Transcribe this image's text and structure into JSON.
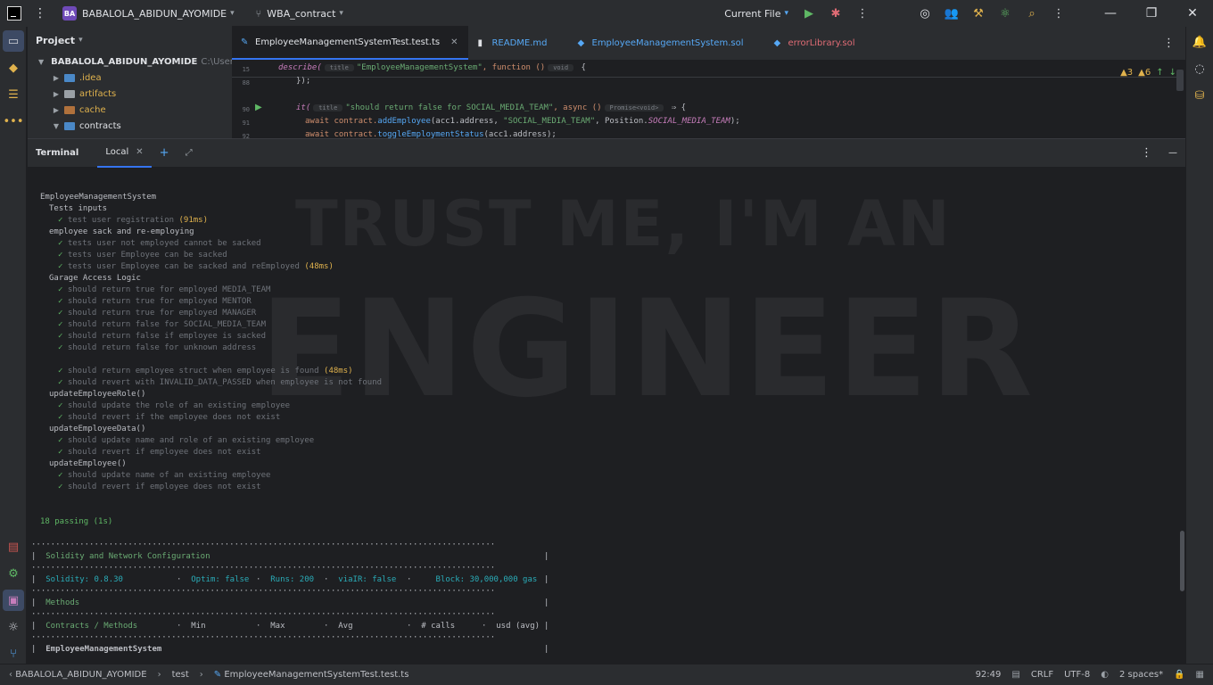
{
  "titlebar": {
    "project_badge": "BA",
    "project_name": "BABALOLA_ABIDUN_AYOMIDE",
    "branch": "WBA_contract",
    "run_config": "Current File"
  },
  "project_panel": {
    "title": "Project",
    "root": "BABALOLA_ABIDUN_AYOMIDE",
    "root_path": "C:\\Users\\",
    "items": [
      ".idea",
      "artifacts",
      "cache",
      "contracts"
    ]
  },
  "editor": {
    "tabs": [
      {
        "label": "EmployeeManagementSystemTest.test.ts"
      },
      {
        "label": "README.md"
      },
      {
        "label": "EmployeeManagementSystem.sol"
      },
      {
        "label": "errorLibrary.sol"
      }
    ],
    "warnings": "▲3",
    "weak_warnings": "▲6",
    "lines": {
      "l15": "15",
      "l88": "88",
      "l90": "90",
      "l91": "91",
      "l92": "92"
    },
    "code": {
      "describe_kw": "describe(",
      "describe_hint": "title",
      "describe_str": "\"EmployeeManagementSystem\"",
      "describe_rest": ", function ()",
      "describe_void": "void",
      "describe_end": " {",
      "close_line": "});",
      "it_kw": "it(",
      "it_hint": "title",
      "it_str": "\"should return false for SOCIAL_MEDIA_TEAM\"",
      "it_rest": ", async ()",
      "it_promise": "Promise<void>",
      "it_end": " ⇒ {",
      "l91_a": "await contract.",
      "l91_fn": "addEmployee",
      "l91_b": "(acc1.address, ",
      "l91_str": "\"SOCIAL_MEDIA_TEAM\"",
      "l91_c": ", Position.",
      "l91_prop": "SOCIAL_MEDIA_TEAM",
      "l91_d": ");",
      "l92_a": "await contract.",
      "l92_fn": "toggleEmploymentStatus",
      "l92_b": "(acc1.address);"
    }
  },
  "terminal": {
    "title": "Terminal",
    "tab": "Local",
    "suite": "EmployeeManagementSystem",
    "groups": [
      {
        "title": "Tests inputs",
        "tests": [
          {
            "name": "test user registration",
            "time": "(91ms)"
          }
        ]
      },
      {
        "title": "employee sack and re-employing",
        "tests": [
          {
            "name": "tests user not employed cannot be sacked",
            "time": ""
          },
          {
            "name": "tests user Employee can be sacked",
            "time": ""
          },
          {
            "name": "tests user Employee can be sacked and reEmployed",
            "time": "(48ms)"
          }
        ]
      },
      {
        "title": "Garage Access Logic",
        "tests": [
          {
            "name": "should return true for employed MEDIA_TEAM",
            "time": ""
          },
          {
            "name": "should return true for employed MENTOR",
            "time": ""
          },
          {
            "name": "should return true for employed MANAGER",
            "time": ""
          },
          {
            "name": "should return false for SOCIAL_MEDIA_TEAM",
            "time": ""
          },
          {
            "name": "should return false if employee is sacked",
            "time": ""
          },
          {
            "name": "should return false for unknown address",
            "time": ""
          }
        ]
      },
      {
        "title": "",
        "tests": [
          {
            "name": "should return employee struct when employee is found",
            "time": "(48ms)"
          },
          {
            "name": "should revert with INVALID_DATA_PASSED when employee is not found",
            "time": ""
          }
        ]
      },
      {
        "title": "updateEmployeeRole()",
        "tests": [
          {
            "name": "should update the role of an existing employee",
            "time": ""
          },
          {
            "name": "should revert if the employee does not exist",
            "time": ""
          }
        ]
      },
      {
        "title": "updateEmployeeData()",
        "tests": [
          {
            "name": "should update name and role of an existing employee",
            "time": ""
          },
          {
            "name": "should revert if employee does not exist",
            "time": ""
          }
        ]
      },
      {
        "title": "updateEmployee()",
        "tests": [
          {
            "name": "should update name of an existing employee",
            "time": ""
          },
          {
            "name": "should revert if employee does not exist",
            "time": ""
          }
        ]
      }
    ],
    "summary": "18 passing (1s)",
    "gas_table": {
      "config_title": "Solidity and Network Configuration",
      "solidity": "Solidity: 0.8.30",
      "optim": "Optim: false",
      "runs": "Runs: 200",
      "viair": "viaIR: false",
      "block": "Block: 30,000,000 gas",
      "methods_title": "Methods",
      "col_contracts": "Contracts / Methods",
      "col_min": "Min",
      "col_max": "Max",
      "col_avg": "Avg",
      "col_calls": "# calls",
      "col_usd": "usd (avg)",
      "contract_row": "EmployeeManagementSystem"
    }
  },
  "watermark": {
    "line1": "TRUST ME, I'M AN",
    "line2": "ENGINEER"
  },
  "statusbar": {
    "crumb_project": "BABALOLA_ABIDUN_AYOMIDE",
    "crumb_folder": "test",
    "crumb_file": "EmployeeManagementSystemTest.test.ts",
    "position": "92:49",
    "line_sep": "CRLF",
    "encoding": "UTF-8",
    "indent": "2 spaces*"
  },
  "icons": {
    "accent": "#3574f0",
    "check": "#5fb865",
    "warning": "#e0b24d"
  }
}
